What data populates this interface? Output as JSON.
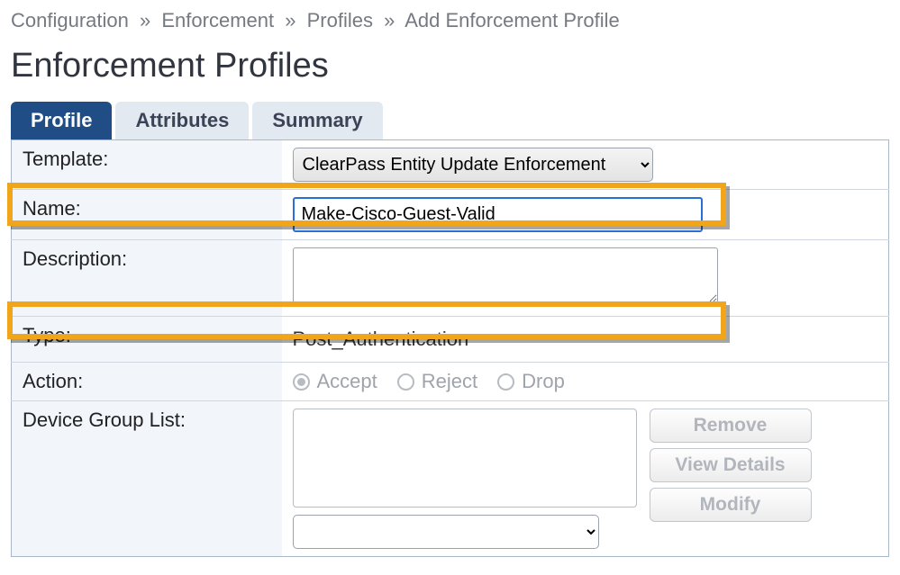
{
  "breadcrumb": {
    "items": [
      "Configuration",
      "Enforcement",
      "Profiles",
      "Add Enforcement Profile"
    ]
  },
  "page": {
    "title": "Enforcement Profiles"
  },
  "tabs": {
    "profile": "Profile",
    "attributes": "Attributes",
    "summary": "Summary"
  },
  "form": {
    "labels": {
      "template": "Template:",
      "name": "Name:",
      "description": "Description:",
      "type": "Type:",
      "action": "Action:",
      "device_group_list": "Device Group List:"
    },
    "template_value": "ClearPass Entity Update Enforcement",
    "name_value": "Make-Cisco-Guest-Valid",
    "description_value": "",
    "type_value": "Post_Authentication",
    "actions": {
      "accept": "Accept",
      "reject": "Reject",
      "drop": "Drop"
    },
    "buttons": {
      "remove": "Remove",
      "view_details": "View Details",
      "modify": "Modify"
    },
    "device_group_select_value": ""
  }
}
